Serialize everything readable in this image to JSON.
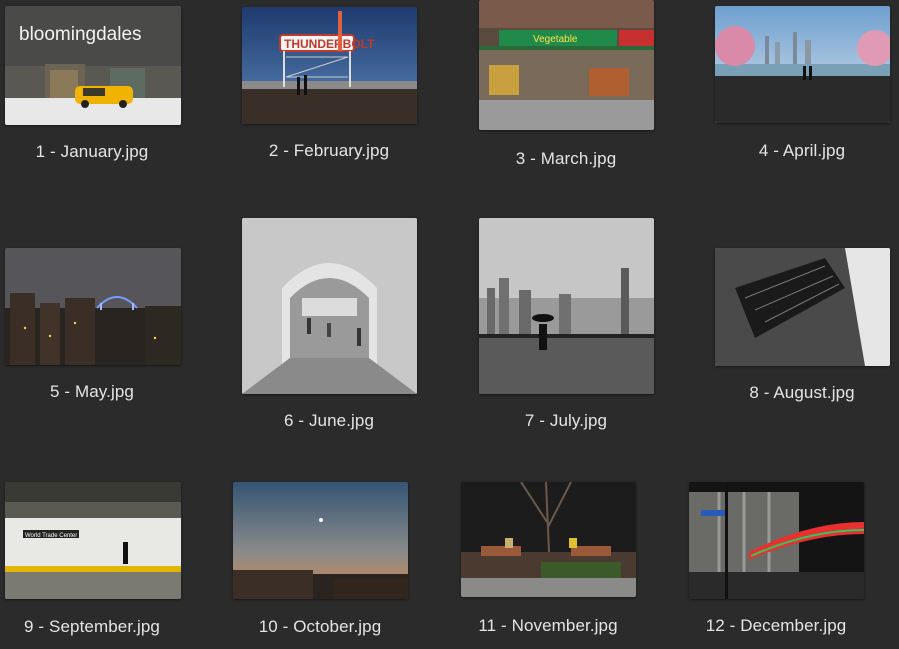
{
  "files": [
    {
      "name": "1 - January.jpg",
      "sign_text": "bloomingdales",
      "icon": "photo-thumbnail"
    },
    {
      "name": "2 - February.jpg",
      "sign_text": "THUNDERBOLT",
      "icon": "photo-thumbnail"
    },
    {
      "name": "3 - March.jpg",
      "sign_text": "Vegetable",
      "icon": "photo-thumbnail"
    },
    {
      "name": "4 - April.jpg",
      "icon": "photo-thumbnail"
    },
    {
      "name": "5 - May.jpg",
      "icon": "photo-thumbnail"
    },
    {
      "name": "6 - June.jpg",
      "icon": "photo-thumbnail"
    },
    {
      "name": "7 - July.jpg",
      "icon": "photo-thumbnail"
    },
    {
      "name": "8 - August.jpg",
      "icon": "photo-thumbnail"
    },
    {
      "name": "9 - September.jpg",
      "sign_text": "World Trade Center",
      "icon": "photo-thumbnail"
    },
    {
      "name": "10 - October.jpg",
      "icon": "photo-thumbnail"
    },
    {
      "name": "11 - November.jpg",
      "icon": "photo-thumbnail"
    },
    {
      "name": "12 - December.jpg",
      "icon": "photo-thumbnail"
    }
  ],
  "colors": {
    "background": "#2b2b2b",
    "label": "#e4e4e4"
  }
}
